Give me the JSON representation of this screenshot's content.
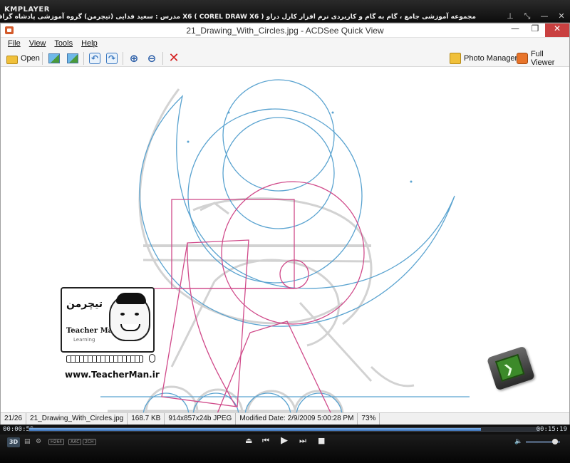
{
  "kmplayer": {
    "logo": "KMPLAYER",
    "title": "مجموعه آموزشی جامع ، گام به گام و کاربردی نرم افزار کارل دراو X6 ( COREL DRAW X6 )   مدرس : سعید فدایی (تیچرمن) گروه آموزشی پادشاه گرافیست ها",
    "controls": [
      "⊥",
      "⤡",
      "—",
      "✕"
    ],
    "time_elapsed": "00:00:59",
    "time_total": "00:15:19",
    "progress": 0.885,
    "badge_3d": "3D",
    "badges": [
      "H264",
      "AAC",
      "2CH"
    ],
    "playback": [
      "⏏",
      "⏮",
      "▶",
      "⏭",
      "■"
    ],
    "volume": 0.85
  },
  "window": {
    "title": "21_Drawing_With_Circles.jpg - ACDSee Quick View",
    "buttons": [
      "—",
      "❐",
      "✕"
    ]
  },
  "menu": [
    "File",
    "View",
    "Tools",
    "Help"
  ],
  "toolbar": {
    "open_label": "Open",
    "photo_manager_label": "Photo Manager",
    "full_viewer_label": "Full Viewer"
  },
  "canvas": {
    "watermark_url": "www.TeacherMan.ir",
    "watermark_name": "Teacher Man",
    "watermark_sub": "Learning",
    "watermark_logo": "تیچرمن"
  },
  "status": {
    "index": "21/26",
    "filename": "21_Drawing_With_Circles.jpg",
    "filesize": "168.7 KB",
    "dimensions": "914x857x24b JPEG",
    "modified": "Modified Date: 2/9/2009 5:00:28 PM",
    "zoom": "73%"
  }
}
